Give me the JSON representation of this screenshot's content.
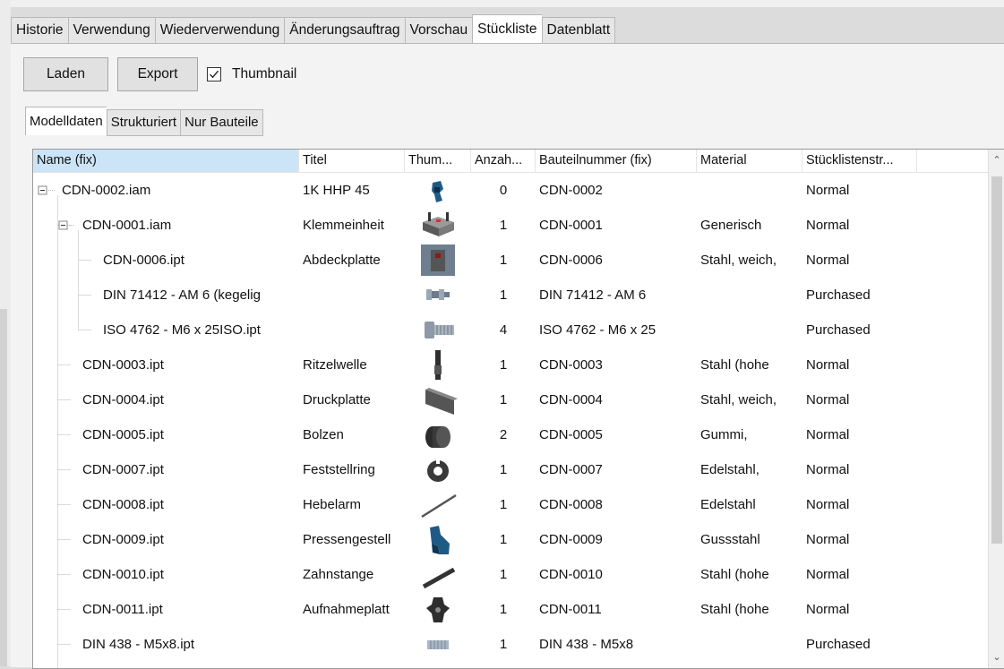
{
  "tabs": [
    {
      "label": "Historie",
      "active": false
    },
    {
      "label": "Verwendung",
      "active": false
    },
    {
      "label": "Wiederverwendung",
      "active": false
    },
    {
      "label": "Änderungsauftrag",
      "active": false
    },
    {
      "label": "Vorschau",
      "active": false
    },
    {
      "label": "Stückliste",
      "active": true
    },
    {
      "label": "Datenblatt",
      "active": false
    }
  ],
  "toolbar": {
    "load_label": "Laden",
    "export_label": "Export",
    "thumbnail_label": "Thumbnail",
    "thumbnail_checked": true
  },
  "subtabs": [
    {
      "label": "Modelldaten",
      "active": true
    },
    {
      "label": "Strukturiert",
      "active": false
    },
    {
      "label": "Nur Bauteile",
      "active": false
    }
  ],
  "grid": {
    "columns": [
      "Name (fix)",
      "Titel",
      "Thum...",
      "Anzah...",
      "Bauteilnummer (fix)",
      "Material",
      "Stücklistenstr..."
    ],
    "rows": [
      {
        "name": "CDN-0002.iam",
        "title": "1K HHP 45",
        "thumb": "hhp-assembly-icon",
        "qty": "0",
        "part": "CDN-0002",
        "material": "",
        "bom": "Normal",
        "level": 0,
        "expander": "minus"
      },
      {
        "name": "CDN-0001.iam",
        "title": "Klemmeinheit",
        "thumb": "clamp-unit-icon",
        "qty": "1",
        "part": "CDN-0001",
        "material": "Generisch",
        "bom": "Normal",
        "level": 1,
        "expander": "minus"
      },
      {
        "name": "CDN-0006.ipt",
        "title": "Abdeckplatte",
        "thumb": "cover-plate-icon",
        "qty": "1",
        "part": "CDN-0006",
        "material": "Stahl, weich,",
        "bom": "Normal",
        "level": 2,
        "expander": ""
      },
      {
        "name": "DIN 71412 - AM 6 (kegelig",
        "title": "",
        "thumb": "grease-nipple-icon",
        "qty": "1",
        "part": "DIN 71412 - AM 6",
        "material": "",
        "bom": "Purchased",
        "level": 2,
        "expander": ""
      },
      {
        "name": "ISO 4762 - M6 x 25ISO.ipt",
        "title": "",
        "thumb": "screw-icon",
        "qty": "4",
        "part": "ISO 4762 - M6 x 25",
        "material": "",
        "bom": "Purchased",
        "level": 2,
        "expander": ""
      },
      {
        "name": "CDN-0003.ipt",
        "title": "Ritzelwelle",
        "thumb": "pinion-shaft-icon",
        "qty": "1",
        "part": "CDN-0003",
        "material": "Stahl (hohe",
        "bom": "Normal",
        "level": 1,
        "expander": ""
      },
      {
        "name": "CDN-0004.ipt",
        "title": "Druckplatte",
        "thumb": "pressure-plate-icon",
        "qty": "1",
        "part": "CDN-0004",
        "material": "Stahl, weich,",
        "bom": "Normal",
        "level": 1,
        "expander": ""
      },
      {
        "name": "CDN-0005.ipt",
        "title": "Bolzen",
        "thumb": "bolt-icon",
        "qty": "2",
        "part": "CDN-0005",
        "material": "Gummi,",
        "bom": "Normal",
        "level": 1,
        "expander": ""
      },
      {
        "name": "CDN-0007.ipt",
        "title": "Feststellring",
        "thumb": "locking-ring-icon",
        "qty": "1",
        "part": "CDN-0007",
        "material": "Edelstahl,",
        "bom": "Normal",
        "level": 1,
        "expander": ""
      },
      {
        "name": "CDN-0008.ipt",
        "title": "Hebelarm",
        "thumb": "lever-arm-icon",
        "qty": "1",
        "part": "CDN-0008",
        "material": "Edelstahl",
        "bom": "Normal",
        "level": 1,
        "expander": ""
      },
      {
        "name": "CDN-0009.ipt",
        "title": "Pressengestell",
        "thumb": "press-frame-icon",
        "qty": "1",
        "part": "CDN-0009",
        "material": "Gussstahl",
        "bom": "Normal",
        "level": 1,
        "expander": ""
      },
      {
        "name": "CDN-0010.ipt",
        "title": "Zahnstange",
        "thumb": "rack-icon",
        "qty": "1",
        "part": "CDN-0010",
        "material": "Stahl (hohe",
        "bom": "Normal",
        "level": 1,
        "expander": ""
      },
      {
        "name": "CDN-0011.ipt",
        "title": "Aufnahmeplatt",
        "thumb": "mounting-plate-icon",
        "qty": "1",
        "part": "CDN-0011",
        "material": "Stahl (hohe",
        "bom": "Normal",
        "level": 1,
        "expander": ""
      },
      {
        "name": "DIN 438 - M5x8.ipt",
        "title": "",
        "thumb": "set-screw-icon",
        "qty": "1",
        "part": "DIN 438 - M5x8",
        "material": "",
        "bom": "Purchased",
        "level": 1,
        "expander": ""
      }
    ]
  },
  "colors": {
    "header_selected": "#cce4f7",
    "thumb_blue": "#1f5a85",
    "thumb_dark": "#3a3a3a"
  }
}
